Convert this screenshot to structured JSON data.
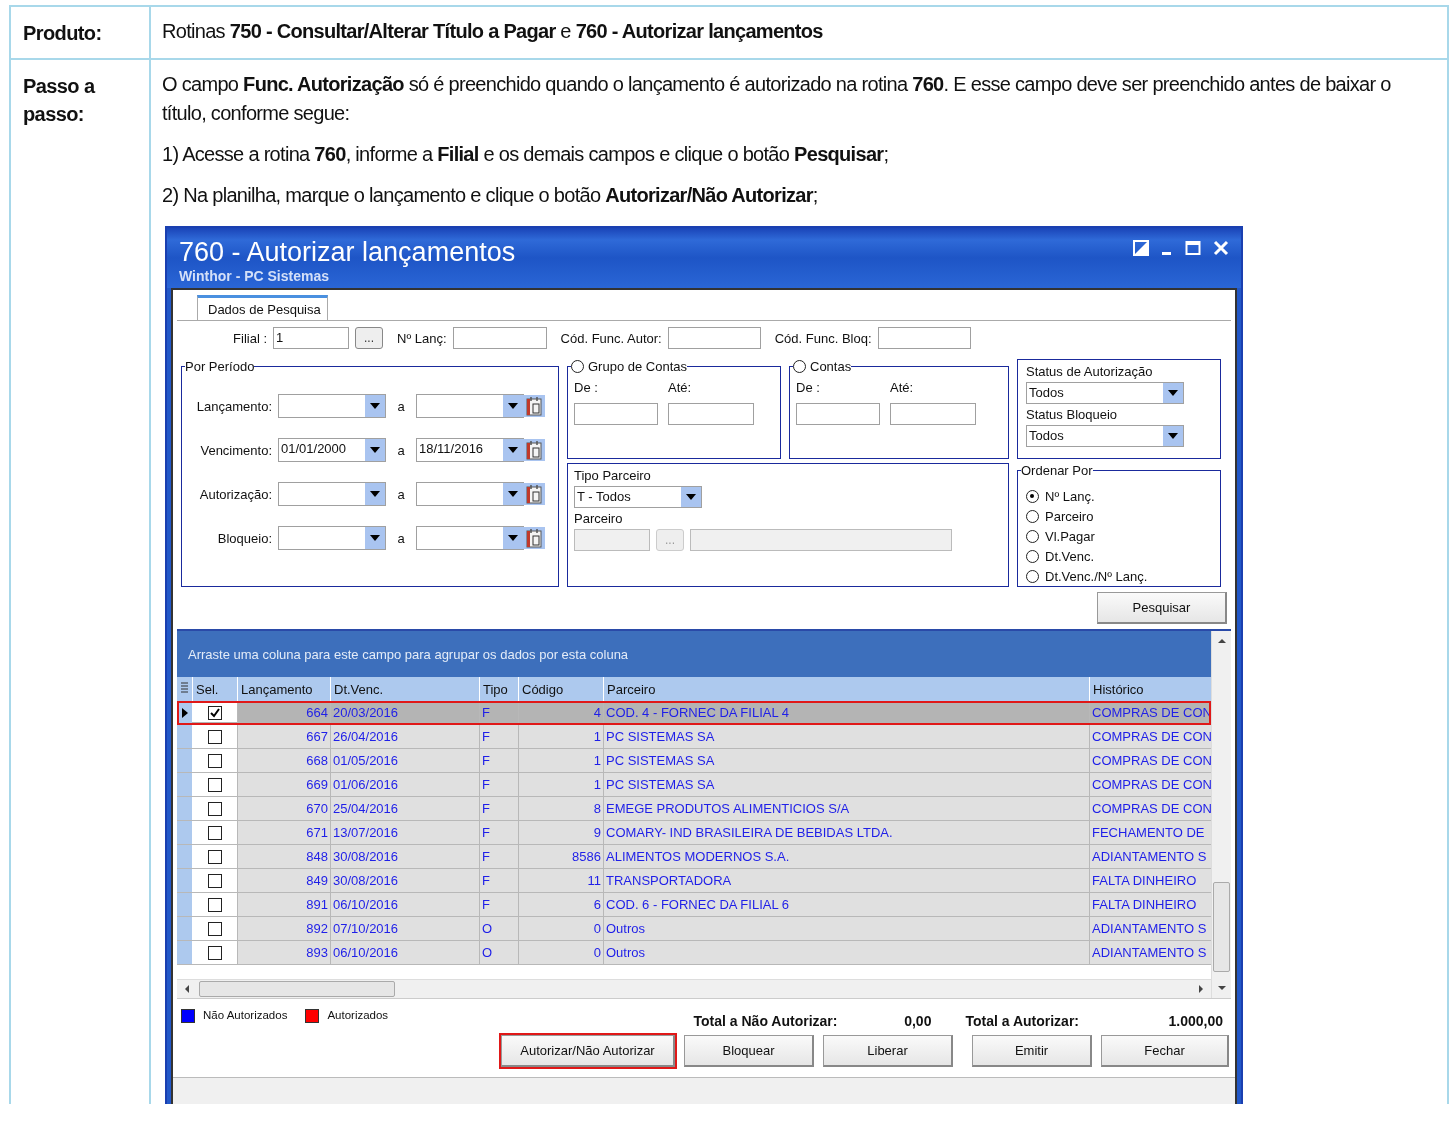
{
  "product": {
    "label": "Produto:",
    "text": "Rotinas **750 - Consultar/Alterar Título a Pagar** e **760 - Autorizar lançamentos**"
  },
  "steps": {
    "label": "Passo a passo:",
    "paragraphs": [
      "O campo **Func. Autorização** só é preenchido quando o lançamento é autorizado na rotina **760**. E esse campo deve ser preenchido antes de baixar o título, conforme segue:",
      "1) Acesse a rotina **760**, informe a **Filial** e os demais campos e clique o botão **Pesquisar**;",
      "2) Na planilha, marque o lançamento e clique o botão **Autorizar/Não Autorizar**;"
    ]
  },
  "window": {
    "title": "760 - Autorizar lançamentos",
    "subtitle": "Winthor - PC Sistemas",
    "tabs": [
      {
        "label": "Dados de Pesquisa",
        "selected": true
      }
    ],
    "filters": {
      "filial_label": "Filial :",
      "filial_value": "1",
      "filial_browse": "...",
      "n_lanc_label": "Nº Lanç:",
      "cod_func_autor_label": "Cód. Func. Autor:",
      "cod_func_bloq_label": "Cód. Func. Bloq:"
    },
    "periodo": {
      "title": "Por Período",
      "rows": [
        {
          "label": "Lançamento:",
          "connector": "a"
        },
        {
          "label": "Vencimento:",
          "from": "01/01/2000",
          "connector": "a",
          "to": "18/11/2016"
        },
        {
          "label": "Autorização:",
          "connector": "a"
        },
        {
          "label": "Bloqueio:",
          "connector": "a"
        }
      ]
    },
    "grupo_contas": {
      "label": "Grupo de Contas",
      "selected": false,
      "from_label": "De :",
      "to_label": "Até:"
    },
    "contas": {
      "label": "Contas",
      "selected": false,
      "from_label": "De :",
      "to_label": "Até:"
    },
    "status": {
      "autorizacao_label": "Status de Autorização",
      "autorizacao_value": "Todos",
      "bloqueio_label": "Status Bloqueio",
      "bloqueio_value": "Todos"
    },
    "tipo_parceiro": {
      "label": "Tipo Parceiro",
      "value": "T - Todos",
      "parceiro_label": "Parceiro",
      "browse": "..."
    },
    "ordenar_por": {
      "title": "Ordenar Por",
      "options": [
        {
          "label": "Nº Lanç.",
          "selected": true
        },
        {
          "label": "Parceiro",
          "selected": false
        },
        {
          "label": "Vl.Pagar",
          "selected": false
        },
        {
          "label": "Dt.Venc.",
          "selected": false
        },
        {
          "label": "Dt.Venc./Nº Lanç.",
          "selected": false
        }
      ]
    },
    "search_button": "Pesquisar",
    "grid": {
      "group_hint": "Arraste uma coluna para este campo para agrupar os dados por esta coluna",
      "columns": [
        "Sel.",
        "Lançamento",
        "Dt.Venc.",
        "Tipo",
        "Código",
        "Parceiro",
        "Histórico"
      ],
      "rows": [
        {
          "checked": true,
          "selected": true,
          "highlighted": true,
          "lancamento": "664",
          "dt_venc": "20/03/2016",
          "tipo": "F",
          "codigo": "4",
          "parceiro": "COD. 4 - FORNEC DA FILIAL 4",
          "historico": "COMPRAS DE CON"
        },
        {
          "checked": false,
          "selected": false,
          "highlighted": false,
          "lancamento": "667",
          "dt_venc": "26/04/2016",
          "tipo": "F",
          "codigo": "1",
          "parceiro": "PC SISTEMAS SA",
          "historico": "COMPRAS DE CON"
        },
        {
          "checked": false,
          "selected": false,
          "highlighted": false,
          "lancamento": "668",
          "dt_venc": "01/05/2016",
          "tipo": "F",
          "codigo": "1",
          "parceiro": "PC SISTEMAS SA",
          "historico": "COMPRAS DE CON"
        },
        {
          "checked": false,
          "selected": false,
          "highlighted": false,
          "lancamento": "669",
          "dt_venc": "01/06/2016",
          "tipo": "F",
          "codigo": "1",
          "parceiro": "PC SISTEMAS SA",
          "historico": "COMPRAS DE CON"
        },
        {
          "checked": false,
          "selected": false,
          "highlighted": false,
          "lancamento": "670",
          "dt_venc": "25/04/2016",
          "tipo": "F",
          "codigo": "8",
          "parceiro": "EMEGE PRODUTOS ALIMENTICIOS S/A",
          "historico": "COMPRAS DE CON"
        },
        {
          "checked": false,
          "selected": false,
          "highlighted": false,
          "lancamento": "671",
          "dt_venc": "13/07/2016",
          "tipo": "F",
          "codigo": "9",
          "parceiro": "COMARY- IND BRASILEIRA DE BEBIDAS LTDA.",
          "historico": "FECHAMENTO DE"
        },
        {
          "checked": false,
          "selected": false,
          "highlighted": false,
          "lancamento": "848",
          "dt_venc": "30/08/2016",
          "tipo": "F",
          "codigo": "8586",
          "parceiro": "ALIMENTOS MODERNOS S.A.",
          "historico": "ADIANTAMENTO S"
        },
        {
          "checked": false,
          "selected": false,
          "highlighted": false,
          "lancamento": "849",
          "dt_venc": "30/08/2016",
          "tipo": "F",
          "codigo": "11",
          "parceiro": "TRANSPORTADORA",
          "historico": "FALTA DINHEIRO"
        },
        {
          "checked": false,
          "selected": false,
          "highlighted": false,
          "lancamento": "891",
          "dt_venc": "06/10/2016",
          "tipo": "F",
          "codigo": "6",
          "parceiro": "COD. 6 - FORNEC DA FILIAL 6",
          "historico": "FALTA DINHEIRO"
        },
        {
          "checked": false,
          "selected": false,
          "highlighted": false,
          "lancamento": "892",
          "dt_venc": "07/10/2016",
          "tipo": "O",
          "codigo": "0",
          "parceiro": "Outros",
          "historico": "ADIANTAMENTO S"
        },
        {
          "checked": false,
          "selected": false,
          "highlighted": false,
          "lancamento": "893",
          "dt_venc": "06/10/2016",
          "tipo": "O",
          "codigo": "0",
          "parceiro": "Outros",
          "historico": "ADIANTAMENTO S"
        }
      ]
    },
    "legend": [
      {
        "label": "Não Autorizados",
        "color": "#0000ff"
      },
      {
        "label": "Autorizados",
        "color": "#ff0000"
      }
    ],
    "totals": [
      {
        "label": "Total a Não Autorizar:",
        "value": "0,00"
      },
      {
        "label": "Total a Autorizar:",
        "value": "1.000,00"
      }
    ],
    "buttons": [
      {
        "label": "Autorizar/Não Autorizar",
        "highlighted": true
      },
      {
        "label": "Bloquear",
        "highlighted": false
      },
      {
        "label": "Liberar",
        "highlighted": false
      },
      {
        "label": "Emitir",
        "highlighted": false
      },
      {
        "label": "Fechar",
        "highlighted": false
      }
    ]
  }
}
